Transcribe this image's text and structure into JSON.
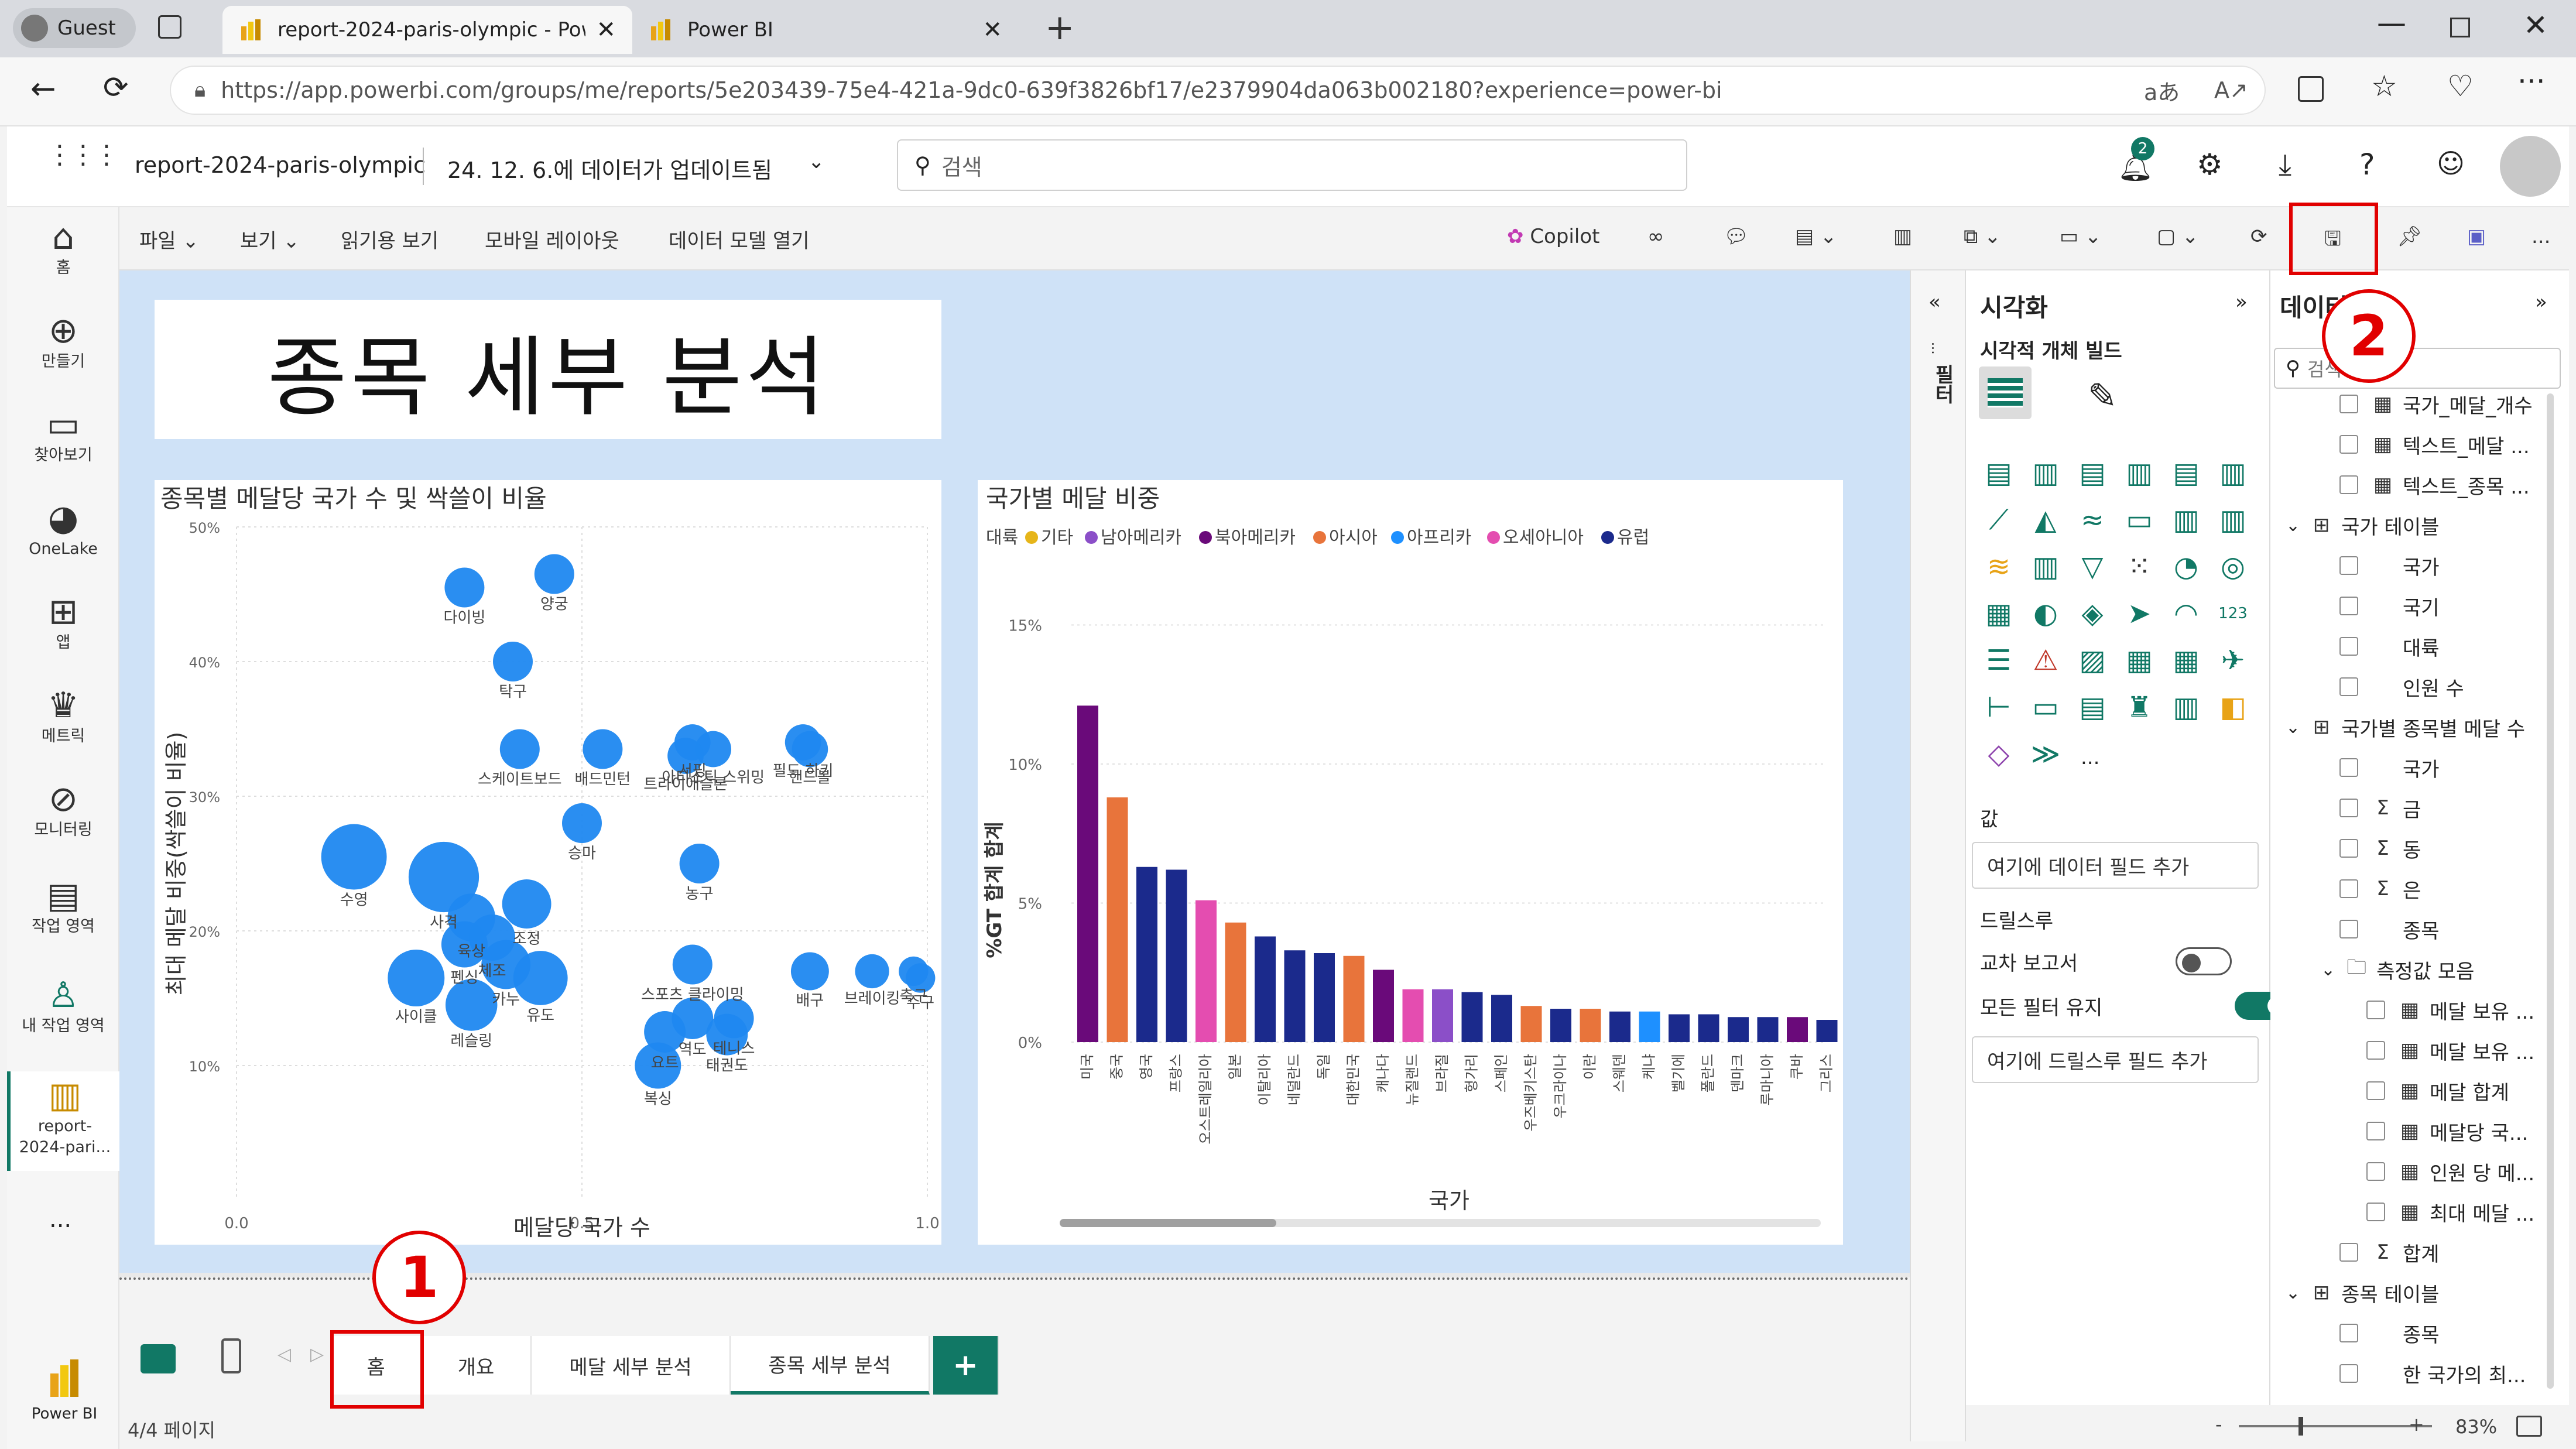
{
  "browser": {
    "profile_label": "Guest",
    "tabs": [
      {
        "title": "report-2024-paris-olympic - Powe"
      },
      {
        "title": "Power BI"
      }
    ],
    "url": "https://app.powerbi.com/groups/me/reports/5e203439-75e4-421a-9dc0-639f3826bf17/e2379904da063b002180?experience=power-bi"
  },
  "header": {
    "report_name": "report-2024-paris-olympic",
    "updated": "24. 12. 6.에 데이터가 업데이트됨",
    "search_placeholder": "검색",
    "notification_count": "2"
  },
  "leftnav": [
    {
      "label": "홈",
      "icon": "home-icon"
    },
    {
      "label": "만들기",
      "icon": "plus-circle-icon"
    },
    {
      "label": "찾아보기",
      "icon": "folder-icon"
    },
    {
      "label": "OneLake",
      "icon": "onelake-icon"
    },
    {
      "label": "앱",
      "icon": "apps-icon"
    },
    {
      "label": "메트릭",
      "icon": "trophy-icon"
    },
    {
      "label": "모니터링",
      "icon": "monitor-icon"
    },
    {
      "label": "작업 영역",
      "icon": "workspaces-icon"
    },
    {
      "label": "내 작업 영역",
      "icon": "person-icon"
    },
    {
      "label": "report-\n2024-pari...",
      "icon": "report-icon"
    }
  ],
  "leftnav_more": "...",
  "leftnav_bottom": "Power BI",
  "ribbon": {
    "file": "파일",
    "view": "보기",
    "reading_view": "읽기용 보기",
    "mobile_layout": "모바일 레이아웃",
    "open_model": "데이터 모델 열기",
    "copilot": "Copilot",
    "more": "..."
  },
  "report": {
    "title": "종목 세부 분석",
    "scatter": {
      "title": "종목별 메달당 국가 수 및 싹쓸이 비율",
      "xlabel": "메달당 국가 수",
      "ylabel": "최대 메달 비중(싹쓸이 비율)",
      "x_ticks": [
        "0.0",
        "0.5",
        "1.0"
      ],
      "y_ticks": [
        "50%",
        "40%",
        "30%",
        "20%",
        "10%"
      ]
    },
    "bar": {
      "title": "국가별 메달 비중",
      "legend_title": "대륙",
      "xlabel": "국가",
      "ylabel": "%GT 합계 합계",
      "y_ticks": [
        "15%",
        "10%",
        "5%",
        "0%"
      ]
    }
  },
  "chart_data": [
    {
      "type": "scatter",
      "title": "종목별 메달당 국가 수 및 싹쓸이 비율",
      "xlabel": "메달당 국가 수",
      "ylabel": "최대 메달 비중(싹쓸이 비율)",
      "xlim": [
        0,
        1
      ],
      "ylim": [
        0,
        0.5
      ],
      "points": [
        {
          "label": "다이빙",
          "x": 0.33,
          "y": 0.455,
          "size": 1
        },
        {
          "label": "양궁",
          "x": 0.46,
          "y": 0.465,
          "size": 1
        },
        {
          "label": "탁구",
          "x": 0.4,
          "y": 0.4,
          "size": 1
        },
        {
          "label": "스케이트보드",
          "x": 0.41,
          "y": 0.335,
          "size": 1
        },
        {
          "label": "배드민턴",
          "x": 0.53,
          "y": 0.335,
          "size": 1
        },
        {
          "label": "서핑",
          "x": 0.66,
          "y": 0.34,
          "size": 0.8
        },
        {
          "label": "아티스틱 스위밍",
          "x": 0.69,
          "y": 0.335,
          "size": 0.8
        },
        {
          "label": "필드 하키",
          "x": 0.82,
          "y": 0.34,
          "size": 0.8
        },
        {
          "label": "트라이애슬론",
          "x": 0.65,
          "y": 0.33,
          "size": 0.8
        },
        {
          "label": "핸드볼",
          "x": 0.83,
          "y": 0.335,
          "size": 0.8
        },
        {
          "label": "승마",
          "x": 0.5,
          "y": 0.28,
          "size": 1
        },
        {
          "label": "농구",
          "x": 0.67,
          "y": 0.25,
          "size": 1
        },
        {
          "label": "수영",
          "x": 0.17,
          "y": 0.255,
          "size": 3
        },
        {
          "label": "사격",
          "x": 0.3,
          "y": 0.24,
          "size": 3.5
        },
        {
          "label": "조정",
          "x": 0.42,
          "y": 0.22,
          "size": 1.6
        },
        {
          "label": "육상",
          "x": 0.34,
          "y": 0.21,
          "size": 1.5
        },
        {
          "label": "체조",
          "x": 0.37,
          "y": 0.195,
          "size": 1.4
        },
        {
          "label": "펜싱",
          "x": 0.33,
          "y": 0.19,
          "size": 1.4
        },
        {
          "label": "카누",
          "x": 0.39,
          "y": 0.175,
          "size": 1.6
        },
        {
          "label": "사이클",
          "x": 0.26,
          "y": 0.165,
          "size": 2.2
        },
        {
          "label": "유도",
          "x": 0.44,
          "y": 0.165,
          "size": 2
        },
        {
          "label": "레슬링",
          "x": 0.34,
          "y": 0.145,
          "size": 1.8
        },
        {
          "label": "스포츠 클라이밍",
          "x": 0.66,
          "y": 0.175,
          "size": 1
        },
        {
          "label": "브레이킹",
          "x": 0.92,
          "y": 0.17,
          "size": 0.7
        },
        {
          "label": "배구",
          "x": 0.83,
          "y": 0.17,
          "size": 0.9
        },
        {
          "label": "축구",
          "x": 0.98,
          "y": 0.17,
          "size": 0.5
        },
        {
          "label": "수구",
          "x": 0.99,
          "y": 0.165,
          "size": 0.5
        },
        {
          "label": "역도",
          "x": 0.66,
          "y": 0.135,
          "size": 1.1
        },
        {
          "label": "테니스",
          "x": 0.72,
          "y": 0.135,
          "size": 1
        },
        {
          "label": "요트",
          "x": 0.62,
          "y": 0.125,
          "size": 1.1
        },
        {
          "label": "태권도",
          "x": 0.71,
          "y": 0.123,
          "size": 1.1
        },
        {
          "label": "복싱",
          "x": 0.61,
          "y": 0.1,
          "size": 1.4
        }
      ]
    },
    {
      "type": "bar",
      "title": "국가별 메달 비중",
      "xlabel": "국가",
      "ylabel": "%GT 합계 합계",
      "ylim": [
        0,
        0.16
      ],
      "legend": [
        {
          "name": "기타",
          "color": "#E6B51A"
        },
        {
          "name": "남아메리카",
          "color": "#8B4FC8"
        },
        {
          "name": "북아메리카",
          "color": "#6A0A7A"
        },
        {
          "name": "아시아",
          "color": "#E8743B"
        },
        {
          "name": "아프리카",
          "color": "#1E90FF"
        },
        {
          "name": "오세아니아",
          "color": "#E44DB0"
        },
        {
          "name": "유럽",
          "color": "#1B2A8C"
        }
      ],
      "categories": [
        "미국",
        "중국",
        "영국",
        "프랑스",
        "오스트레일리아",
        "일본",
        "이탈리아",
        "네덜란드",
        "독일",
        "대한민국",
        "캐나다",
        "뉴질랜드",
        "브라질",
        "헝가리",
        "스페인",
        "우즈베키스탄",
        "우크라이나",
        "이란",
        "스웨덴",
        "케냐",
        "벨기에",
        "폴란드",
        "덴마크",
        "루마니아",
        "쿠바",
        "그리스"
      ],
      "continent": [
        "북아메리카",
        "아시아",
        "유럽",
        "유럽",
        "오세아니아",
        "아시아",
        "유럽",
        "유럽",
        "유럽",
        "아시아",
        "북아메리카",
        "오세아니아",
        "남아메리카",
        "유럽",
        "유럽",
        "아시아",
        "유럽",
        "아시아",
        "유럽",
        "아프리카",
        "유럽",
        "유럽",
        "유럽",
        "유럽",
        "북아메리카",
        "유럽"
      ],
      "values": [
        0.121,
        0.088,
        0.063,
        0.062,
        0.051,
        0.043,
        0.038,
        0.033,
        0.032,
        0.031,
        0.026,
        0.019,
        0.019,
        0.018,
        0.017,
        0.013,
        0.012,
        0.012,
        0.011,
        0.011,
        0.01,
        0.01,
        0.009,
        0.009,
        0.009,
        0.008
      ]
    }
  ],
  "pages": {
    "tabs": [
      "홈",
      "개요",
      "메달 세부 분석",
      "종목 세부 분석"
    ],
    "active": "종목 세부 분석",
    "add": "+",
    "indicator": "4/4 페이지"
  },
  "filters": {
    "label": "필터"
  },
  "viz_pane": {
    "title": "시각화",
    "build": "시각적 개체 빌드",
    "values_label": "값",
    "values_placeholder": "여기에 데이터 필드 추가",
    "drill_label": "드릴스루",
    "cross_report": "교차 보고서",
    "keep_filters": "모든 필터 유지",
    "drill_placeholder": "여기에 드릴스루 필드 추가",
    "more": "..."
  },
  "data_pane": {
    "title": "데이터",
    "search_placeholder": "검색",
    "items": [
      {
        "label": "국가_메달_개수",
        "kind": "measure",
        "level": 1
      },
      {
        "label": "텍스트_메달 ...",
        "kind": "measure",
        "level": 1
      },
      {
        "label": "텍스트_종목 ...",
        "kind": "measure",
        "level": 1
      },
      {
        "label": "국가 테이블",
        "kind": "table",
        "level": 0
      },
      {
        "label": "국가",
        "kind": "field",
        "level": 1
      },
      {
        "label": "국기",
        "kind": "field",
        "level": 1
      },
      {
        "label": "대륙",
        "kind": "field",
        "level": 1
      },
      {
        "label": "인원 수",
        "kind": "field",
        "level": 1
      },
      {
        "label": "국가별 종목별 메달 수",
        "kind": "table",
        "level": 0
      },
      {
        "label": "국가",
        "kind": "field",
        "level": 1
      },
      {
        "label": "금",
        "kind": "sum",
        "level": 1
      },
      {
        "label": "동",
        "kind": "sum",
        "level": 1
      },
      {
        "label": "은",
        "kind": "sum",
        "level": 1
      },
      {
        "label": "종목",
        "kind": "field",
        "level": 1
      },
      {
        "label": "측정값 모음",
        "kind": "folder",
        "level": 1
      },
      {
        "label": "메달 보유 ...",
        "kind": "measure",
        "level": 2
      },
      {
        "label": "메달 보유 ...",
        "kind": "measure",
        "level": 2
      },
      {
        "label": "메달 합계",
        "kind": "measure",
        "level": 2
      },
      {
        "label": "메달당 국...",
        "kind": "measure",
        "level": 2
      },
      {
        "label": "인원 당 메...",
        "kind": "measure",
        "level": 2
      },
      {
        "label": "최대 메달 ...",
        "kind": "measure",
        "level": 2
      },
      {
        "label": "합계",
        "kind": "sum",
        "level": 1
      },
      {
        "label": "종목 테이블",
        "kind": "table",
        "level": 0
      },
      {
        "label": "종목",
        "kind": "field",
        "level": 1
      },
      {
        "label": "한 국가의 최...",
        "kind": "field",
        "level": 1
      }
    ]
  },
  "zoom": {
    "minus": "-",
    "plus": "+",
    "percent": "83%"
  },
  "annotations": {
    "step1": "1",
    "step2": "2"
  }
}
